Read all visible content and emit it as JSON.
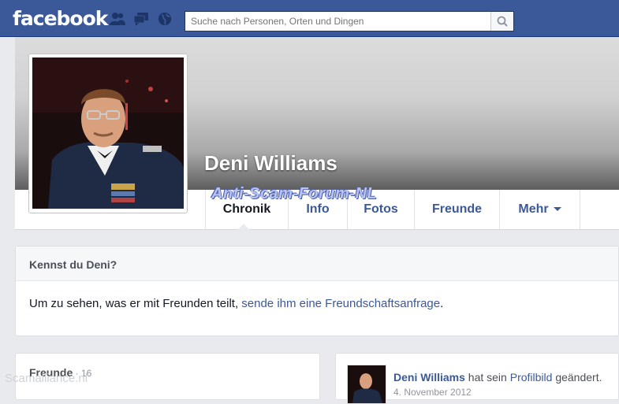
{
  "header": {
    "logo": "facebook",
    "search_placeholder": "Suche nach Personen, Orten und Dingen",
    "icons": [
      "friend-requests-icon",
      "messages-icon",
      "notifications-globe-icon",
      "search-icon"
    ]
  },
  "profile": {
    "name": "Deni Williams",
    "watermark": "Anti-Scam-Forum-NL"
  },
  "tabs": [
    {
      "label": "Chronik"
    },
    {
      "label": "Info"
    },
    {
      "label": "Fotos"
    },
    {
      "label": "Freunde"
    },
    {
      "label": "Mehr"
    }
  ],
  "know_card": {
    "title": "Kennst du Deni?",
    "text_prefix": "Um zu sehen, was er mit Freunden teilt, ",
    "link": "sende ihm eine Freundschaftsanfrage",
    "text_suffix": "."
  },
  "friends_card": {
    "title": "Freunde",
    "separator": " · ",
    "count": "16",
    "overlay": "Scamalliance.nl"
  },
  "post": {
    "author": "Deni Williams",
    "action": " hat sein ",
    "object": "Profilbild",
    "action_end": " geändert.",
    "date": "4. November 2012"
  },
  "colors": {
    "brand_blue": "#3b5998",
    "background": "#e9eaed",
    "text": "#141823"
  }
}
